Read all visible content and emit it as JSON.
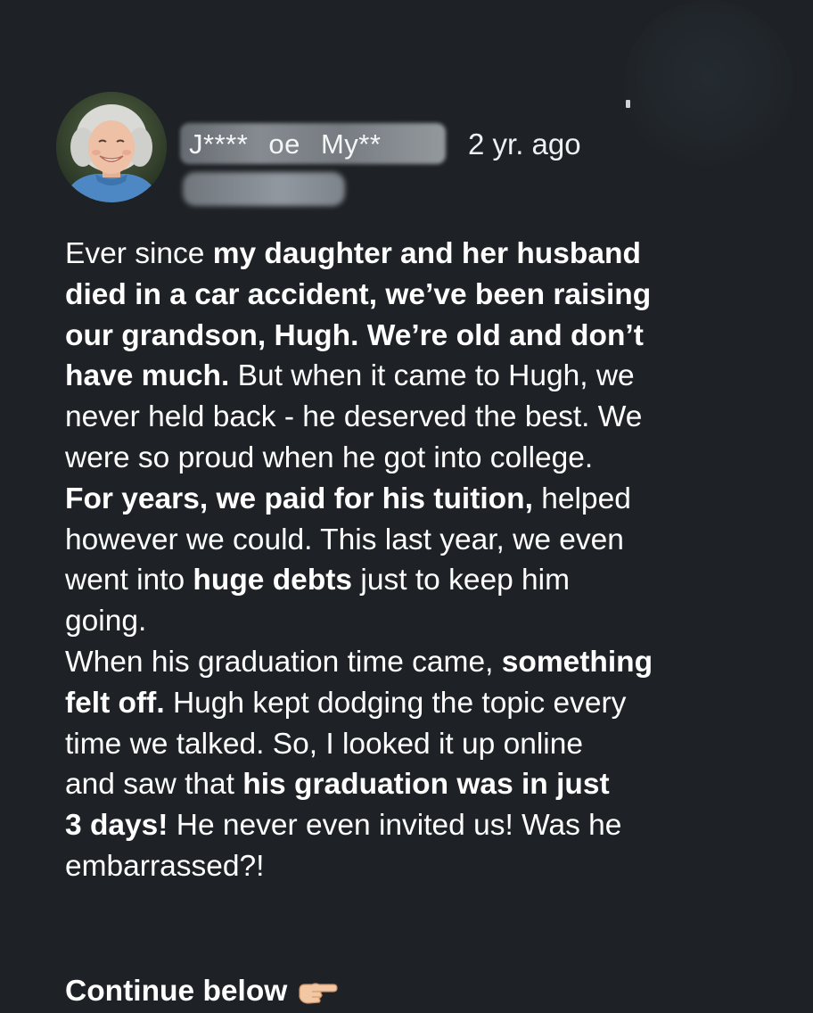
{
  "header": {
    "username": "J**** oe My**",
    "timestamp": "2 yr. ago"
  },
  "post": {
    "lines": [
      [
        {
          "t": "Ever since ",
          "b": false
        },
        {
          "t": "my daughter and her husband",
          "b": true
        }
      ],
      [
        {
          "t": "died in a car accident, we’ve been raising",
          "b": true
        }
      ],
      [
        {
          "t": "our grandson, Hugh. We’re old and don’t",
          "b": true
        }
      ],
      [
        {
          "t": "have much.",
          "b": true
        },
        {
          "t": " But when it came to Hugh, we",
          "b": false
        }
      ],
      [
        {
          "t": "never held back - he deserved the best. We",
          "b": false
        }
      ],
      [
        {
          "t": "were so proud when he got into college.",
          "b": false
        }
      ],
      [
        {
          "t": "For years, we paid for his tuition,",
          "b": true
        },
        {
          "t": " helped",
          "b": false
        }
      ],
      [
        {
          "t": "however we could. This last year, we even",
          "b": false
        }
      ],
      [
        {
          "t": "went into ",
          "b": false
        },
        {
          "t": "huge debts",
          "b": true
        },
        {
          "t": " just to keep him",
          "b": false
        }
      ],
      [
        {
          "t": "going.",
          "b": false
        }
      ],
      [
        {
          "t": "When his graduation time came, ",
          "b": false
        },
        {
          "t": "something",
          "b": true
        }
      ],
      [
        {
          "t": "felt off.",
          "b": true
        },
        {
          "t": " Hugh kept dodging the topic every",
          "b": false
        }
      ],
      [
        {
          "t": "time we talked. So, I looked it up online",
          "b": false
        }
      ],
      [
        {
          "t": "and saw that ",
          "b": false
        },
        {
          "t": "his graduation was in just",
          "b": true
        }
      ],
      [
        {
          "t": "3 days!",
          "b": true
        },
        {
          "t": " He never even invited us! Was he",
          "b": false
        }
      ],
      [
        {
          "t": "embarrassed?!",
          "b": false
        }
      ]
    ]
  },
  "footer": {
    "continue_label": "Continue below",
    "continue_icon": "pointing-right-hand-icon"
  }
}
